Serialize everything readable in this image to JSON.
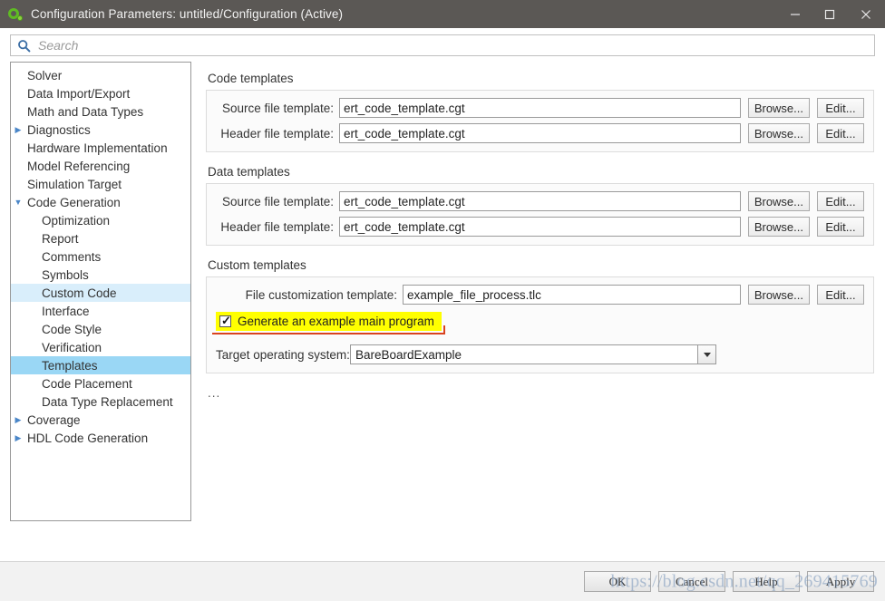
{
  "window": {
    "title": "Configuration Parameters: untitled/Configuration (Active)",
    "app_icon": "simulink-icon",
    "minimize_label": "─",
    "maximize_label": "□",
    "close_label": "✕",
    "titlebar_color": "#5b5855"
  },
  "search": {
    "placeholder": "Search",
    "value": "",
    "icon": "search-icon",
    "icon_color": "#3b6ea5"
  },
  "sidebar": {
    "items": [
      {
        "label": "Solver",
        "level": 0,
        "twisty": "",
        "state": "normal"
      },
      {
        "label": "Data Import/Export",
        "level": 0,
        "twisty": "",
        "state": "normal"
      },
      {
        "label": "Math and Data Types",
        "level": 0,
        "twisty": "",
        "state": "normal"
      },
      {
        "label": "Diagnostics",
        "level": 0,
        "twisty": "▶",
        "state": "normal"
      },
      {
        "label": "Hardware Implementation",
        "level": 0,
        "twisty": "",
        "state": "normal"
      },
      {
        "label": "Model Referencing",
        "level": 0,
        "twisty": "",
        "state": "normal"
      },
      {
        "label": "Simulation Target",
        "level": 0,
        "twisty": "",
        "state": "normal"
      },
      {
        "label": "Code Generation",
        "level": 0,
        "twisty": "▼",
        "state": "normal"
      },
      {
        "label": "Optimization",
        "level": 1,
        "twisty": "",
        "state": "normal"
      },
      {
        "label": "Report",
        "level": 1,
        "twisty": "",
        "state": "normal"
      },
      {
        "label": "Comments",
        "level": 1,
        "twisty": "",
        "state": "normal"
      },
      {
        "label": "Symbols",
        "level": 1,
        "twisty": "",
        "state": "normal"
      },
      {
        "label": "Custom Code",
        "level": 1,
        "twisty": "",
        "state": "hover"
      },
      {
        "label": "Interface",
        "level": 1,
        "twisty": "",
        "state": "normal"
      },
      {
        "label": "Code Style",
        "level": 1,
        "twisty": "",
        "state": "normal"
      },
      {
        "label": "Verification",
        "level": 1,
        "twisty": "",
        "state": "normal"
      },
      {
        "label": "Templates",
        "level": 1,
        "twisty": "",
        "state": "selected"
      },
      {
        "label": "Code Placement",
        "level": 1,
        "twisty": "",
        "state": "normal"
      },
      {
        "label": "Data Type Replacement",
        "level": 1,
        "twisty": "",
        "state": "normal"
      },
      {
        "label": "Coverage",
        "level": 0,
        "twisty": "▶",
        "state": "normal"
      },
      {
        "label": "HDL Code Generation",
        "level": 0,
        "twisty": "▶",
        "state": "normal"
      }
    ],
    "selected_color": "#9ad7f5",
    "hover_color": "#d9eefb"
  },
  "main": {
    "code_templates": {
      "title": "Code templates",
      "source_label": "Source file template:",
      "source_value": "ert_code_template.cgt",
      "header_label": "Header file template:",
      "header_value": "ert_code_template.cgt",
      "browse_label": "Browse...",
      "edit_label": "Edit..."
    },
    "data_templates": {
      "title": "Data templates",
      "source_label": "Source file template:",
      "source_value": "ert_code_template.cgt",
      "header_label": "Header file template:",
      "header_value": "ert_code_template.cgt",
      "browse_label": "Browse...",
      "edit_label": "Edit..."
    },
    "custom_templates": {
      "title": "Custom templates",
      "file_custom_label": "File customization template:",
      "file_custom_value": "example_file_process.tlc",
      "browse_label": "Browse...",
      "edit_label": "Edit...",
      "checkbox_label": "Generate an example main program",
      "checkbox_checked": true,
      "checkbox_mark": "✓",
      "highlight_color": "#ffff00",
      "annotation_color": "#d9441f",
      "target_os_label": "Target operating system:",
      "target_os_value": "BareBoardExample"
    },
    "ellipsis": "..."
  },
  "footer": {
    "ok_label": "OK",
    "cancel_label": "Cancel",
    "help_label": "Help",
    "apply_label": "Apply",
    "watermark": "https://blog.csdn.net/qq_269415769"
  }
}
